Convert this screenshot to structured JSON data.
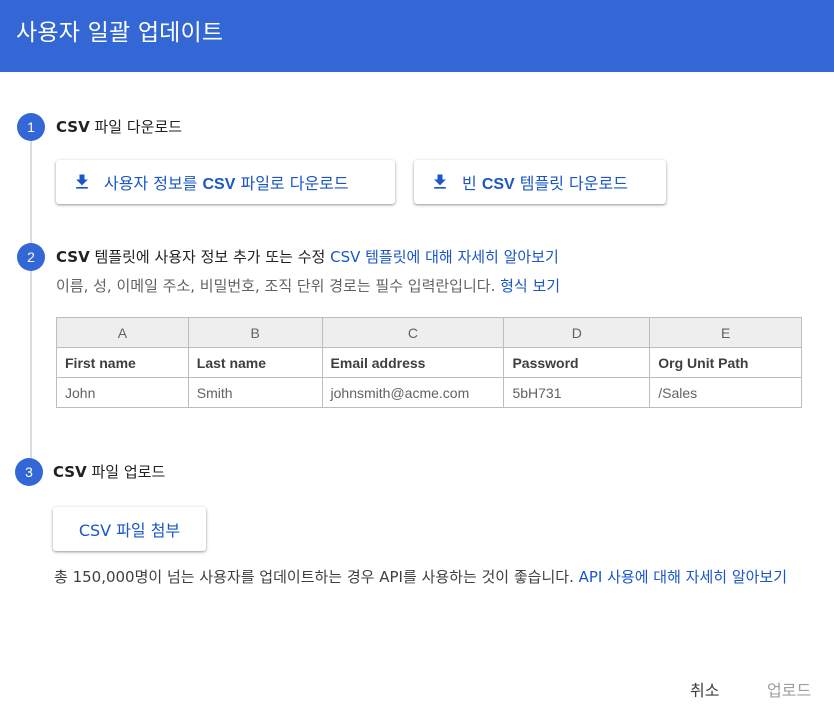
{
  "header": {
    "title": "사용자 일괄 업데이트",
    "color": "#3367d6"
  },
  "steps": [
    {
      "number": "1",
      "title_csv": "CSV",
      "title_rest": " 파일 다운로드",
      "buttons": [
        {
          "icon": "download-icon",
          "prefix": "사용자 정보를 ",
          "csv": "CSV",
          "suffix": " 파일로 다운로드"
        },
        {
          "icon": "download-icon",
          "prefix": "빈 ",
          "csv": "CSV",
          "suffix": " 템플릿 다운로드"
        }
      ]
    },
    {
      "number": "2",
      "title_csv": "CSV",
      "title_rest": " 템플릿에 사용자 정보 추가 또는 수정 ",
      "title_link": "CSV 템플릿에 대해 자세히 알아보기",
      "description": "이름, 성, 이메일 주소, 비밀번호, 조직 단위 경로는 필수 입력란입니다. ",
      "description_link": "형식 보기",
      "table": {
        "column_letters": [
          "A",
          "B",
          "C",
          "D",
          "E"
        ],
        "headers": [
          "First name",
          "Last name",
          "Email address",
          "Password",
          "Org Unit Path"
        ],
        "row": [
          "John",
          "Smith",
          "johnsmith@acme.com",
          "5bH731",
          "/Sales"
        ]
      }
    },
    {
      "number": "3",
      "title_csv": "CSV",
      "title_rest": " 파일 업로드",
      "attach_button": "CSV 파일 첨부",
      "note": "총 150,000명이 넘는 사용자를 업데이트하는 경우 API를 사용하는 것이 좋습니다. ",
      "note_link": "API 사용에 대해 자세히 알아보기"
    }
  ],
  "footer": {
    "cancel": "취소",
    "upload": "업로드"
  },
  "colors": {
    "accent": "#3367d6",
    "link": "#1a56c8",
    "disabled": "#9aa0a6"
  }
}
